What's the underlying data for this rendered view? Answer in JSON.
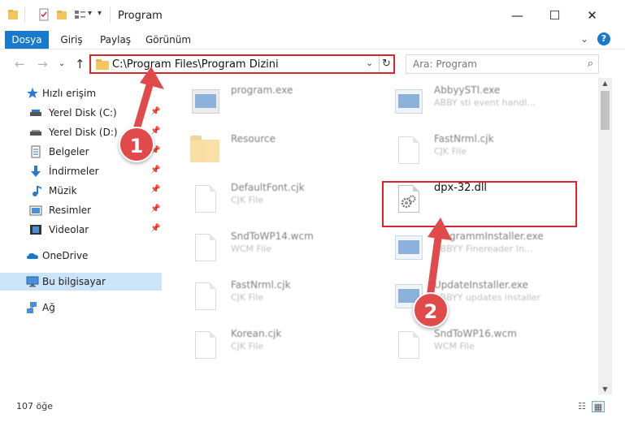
{
  "window": {
    "title": "Program",
    "minimize": "—",
    "maximize": "☐",
    "close": "✕"
  },
  "ribbon": {
    "tabs": [
      "Dosya",
      "Giriş",
      "Paylaş",
      "Görünüm"
    ],
    "expand": "⌄",
    "help": "?"
  },
  "address": {
    "path": "C:\\Program Files\\Program Dizini",
    "search_placeholder": "Ara: Program",
    "back": "←",
    "forward": "→",
    "recent": "⌄",
    "up": "↑",
    "dropdown": "⌄",
    "refresh": "↻",
    "search_icon": "⌕"
  },
  "nav": {
    "items": [
      {
        "label": "Hızlı erişim",
        "icon": "star-icon"
      },
      {
        "label": "Yerel Disk (C:)",
        "icon": "drive-icon"
      },
      {
        "label": "Yerel Disk (D:)",
        "icon": "drive-icon"
      },
      {
        "label": "Belgeler",
        "icon": "documents-icon"
      },
      {
        "label": "İndirmeler",
        "icon": "download-icon"
      },
      {
        "label": "Müzik",
        "icon": "music-icon"
      },
      {
        "label": "Resimler",
        "icon": "pictures-icon"
      },
      {
        "label": "Videolar",
        "icon": "video-icon"
      },
      {
        "label": "OneDrive",
        "icon": "cloud-icon"
      },
      {
        "label": "Bu bilgisayar",
        "icon": "computer-icon"
      },
      {
        "label": "Ağ",
        "icon": "network-icon"
      }
    ],
    "pin_glyph": "📌"
  },
  "files": [
    {
      "name": "program.exe",
      "type": ""
    },
    {
      "name": "AbbyySTI.exe",
      "type": "ABBY sti event handl..."
    },
    {
      "name": "Resource",
      "type": ""
    },
    {
      "name": "FastNrml.cjk",
      "type": "CJK File"
    },
    {
      "name": "DefaultFont.cjk",
      "type": "CJK File"
    },
    {
      "name": "dpx-32.dll",
      "type": ""
    },
    {
      "name": "SndToWP14.wcm",
      "type": "WCM File"
    },
    {
      "name": "ProgrammInstaller.exe",
      "type": "ABBYY Finereader In..."
    },
    {
      "name": "FastNrml.cjk",
      "type": "CJK File"
    },
    {
      "name": "UpdateInstaller.exe",
      "type": "ABBYY updates installer"
    },
    {
      "name": "Korean.cjk",
      "type": "CJK File"
    },
    {
      "name": "SndToWP16.wcm",
      "type": "WCM File"
    }
  ],
  "status": {
    "count": "107 öğe"
  },
  "annotations": {
    "badge1": "1",
    "badge2": "2",
    "color": "#e04a4a"
  }
}
